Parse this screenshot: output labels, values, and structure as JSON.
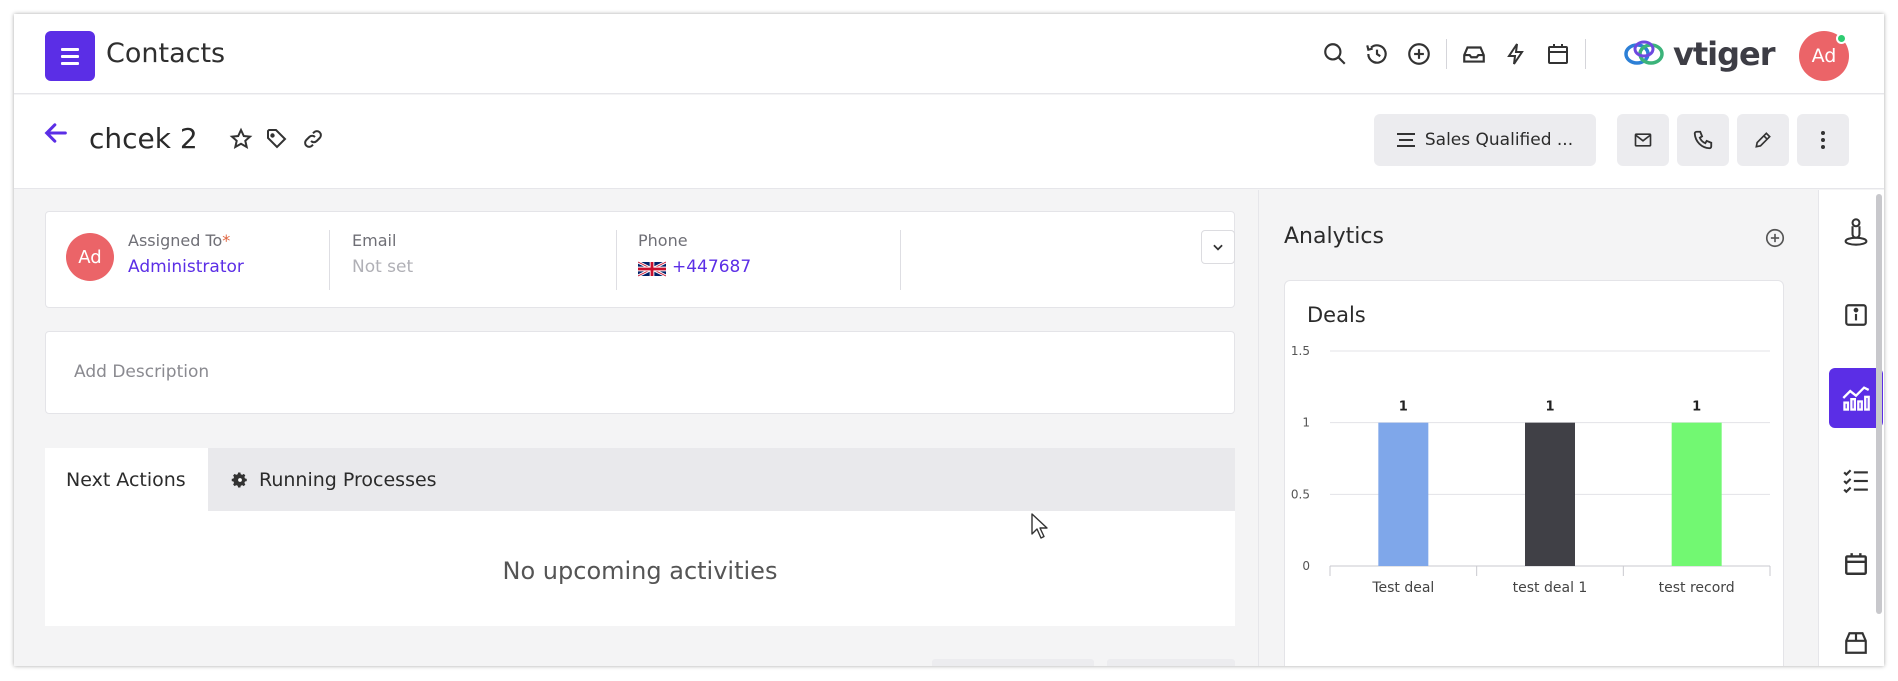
{
  "header": {
    "app_title": "Contacts",
    "icons": [
      "search-icon",
      "history-icon",
      "add-circle-icon",
      "inbox-icon",
      "lightning-icon",
      "calendar-icon"
    ],
    "logo_text": "vtiger",
    "user_initials": "Ad"
  },
  "record": {
    "title": "chcek 2",
    "stage_label": "Sales Qualified ...",
    "actions": [
      "email-icon",
      "phone-icon",
      "edit-icon",
      "more-icon"
    ]
  },
  "summary": {
    "avatar_initials": "Ad",
    "assigned_label": "Assigned To",
    "assigned_required": "*",
    "assigned_value": "Administrator",
    "email_label": "Email",
    "email_value": "Not set",
    "phone_label": "Phone",
    "phone_value": "+447687"
  },
  "description": {
    "placeholder": "Add Description"
  },
  "tabs": [
    {
      "label": "Next Actions",
      "active": true
    },
    {
      "label": "Running Processes",
      "active": false
    }
  ],
  "activities": {
    "empty_text": "No upcoming activities"
  },
  "analytics": {
    "title": "Analytics",
    "deals_title": "Deals"
  },
  "chart_data": {
    "type": "bar",
    "title": "Deals",
    "categories": [
      "Test deal",
      "test deal 1",
      "test record"
    ],
    "values": [
      1,
      1,
      1
    ],
    "colors": [
      "#7fa7ea",
      "#404046",
      "#72f872"
    ],
    "yticks": [
      "0",
      "0.5",
      "1",
      "1.5"
    ],
    "ylim": [
      0,
      1.5
    ],
    "data_labels": [
      "1",
      "1",
      "1"
    ],
    "grid": true
  },
  "rail": {
    "items": [
      "key-person-icon",
      "info-icon",
      "analytics-icon",
      "checklist-icon",
      "calendar-icon",
      "box-icon"
    ],
    "active_index": 2
  },
  "colors": {
    "accent": "#5b2ee6",
    "avatar": "#eb6468"
  }
}
